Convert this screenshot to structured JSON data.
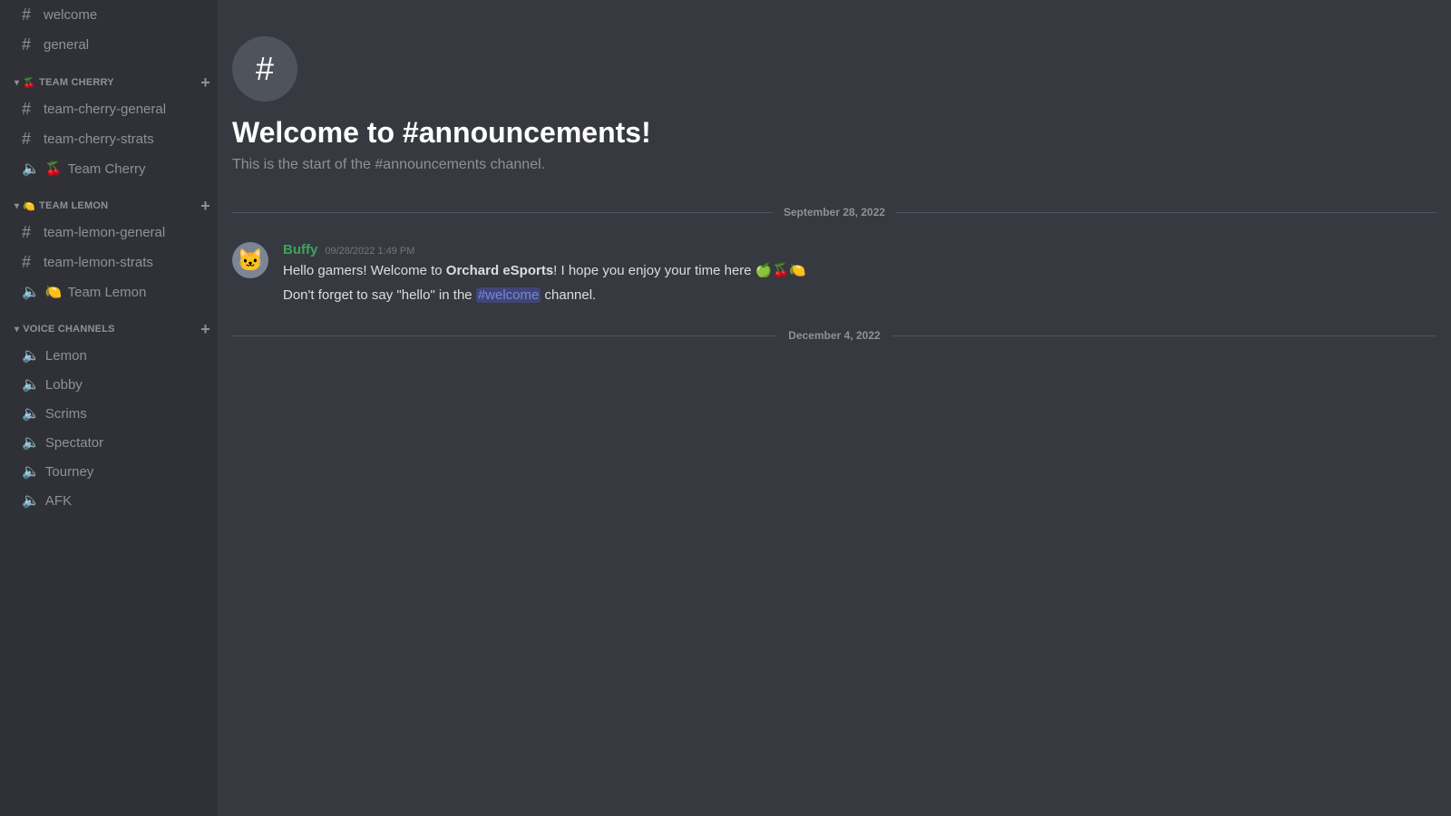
{
  "sidebar": {
    "top_channels": [
      {
        "name": "welcome",
        "type": "text"
      },
      {
        "name": "general",
        "type": "text"
      }
    ],
    "categories": [
      {
        "id": "team-cherry",
        "label": "TEAM CHERRY",
        "emoji": "🍒",
        "channels": [
          {
            "name": "team-cherry-general",
            "type": "text"
          },
          {
            "name": "team-cherry-strats",
            "type": "text"
          }
        ],
        "voice_channels": [
          {
            "name": "Team Cherry",
            "emoji": "🍒"
          }
        ]
      },
      {
        "id": "team-lemon",
        "label": "TEAM LEMON",
        "emoji": "🍋",
        "channels": [
          {
            "name": "team-lemon-general",
            "type": "text"
          },
          {
            "name": "team-lemon-strats",
            "type": "text"
          }
        ],
        "voice_channels": [
          {
            "name": "Team Lemon",
            "emoji": "🍋"
          }
        ]
      },
      {
        "id": "voice-channels",
        "label": "VOICE CHANNELS",
        "emoji": null,
        "channels": [],
        "voice_channels": [
          {
            "name": "Lemon",
            "emoji": null
          },
          {
            "name": "Lobby",
            "emoji": null
          },
          {
            "name": "Scrims",
            "emoji": null
          },
          {
            "name": "Spectator",
            "emoji": null
          },
          {
            "name": "Tourney",
            "emoji": null
          },
          {
            "name": "AFK",
            "emoji": null
          }
        ]
      }
    ]
  },
  "main": {
    "channel_name": "announcements",
    "welcome_title": "Welcome to #announcements!",
    "welcome_subtitle": "This is the start of the #announcements channel.",
    "date_dividers": [
      {
        "date": "September 28, 2022"
      },
      {
        "date": "December 4, 2022"
      }
    ],
    "messages": [
      {
        "author": "Buffy",
        "timestamp": "09/28/2022 1:49 PM",
        "lines": [
          "Hello gamers! Welcome to **Orchard eSports**! I hope you enjoy your time here 🍏🍒🍋",
          "Don't forget to say \"hello\" in the #welcome channel."
        ]
      }
    ]
  }
}
